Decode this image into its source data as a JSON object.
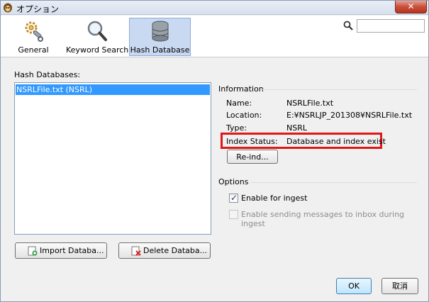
{
  "window": {
    "title": "オプション",
    "close_label": "✕"
  },
  "toolbar": {
    "tabs": [
      {
        "label": "General",
        "icon": "wrench-gear-icon"
      },
      {
        "label": "Keyword Search",
        "icon": "magnifier-icon"
      },
      {
        "label": "Hash Database",
        "icon": "database-icon"
      }
    ],
    "search": {
      "value": "",
      "placeholder": ""
    }
  },
  "hash_databases": {
    "label": "Hash Databases:",
    "items": [
      "NSRLFile.txt (NSRL)"
    ],
    "import_label": "Import Databa...",
    "delete_label": "Delete Databa..."
  },
  "information": {
    "title": "Information",
    "name_label": "Name:",
    "name_value": "NSRLFile.txt",
    "location_label": "Location:",
    "location_value": "E:¥NSRLJP_201308¥NSRLFile.txt",
    "type_label": "Type:",
    "type_value": "NSRL",
    "index_status_label": "Index Status:",
    "index_status_value": "Database and index exist",
    "reindex_label": "Re-ind..."
  },
  "options": {
    "title": "Options",
    "enable_ingest_label": "Enable for ingest",
    "enable_ingest_checked": true,
    "enable_inbox_label": "Enable sending messages to inbox during ingest",
    "enable_inbox_checked": false
  },
  "footer": {
    "ok_label": "OK",
    "cancel_label": "取消"
  },
  "colors": {
    "selection": "#3399ff",
    "highlight_border": "#e0161a",
    "tab_selected": "#c9d9f2"
  }
}
